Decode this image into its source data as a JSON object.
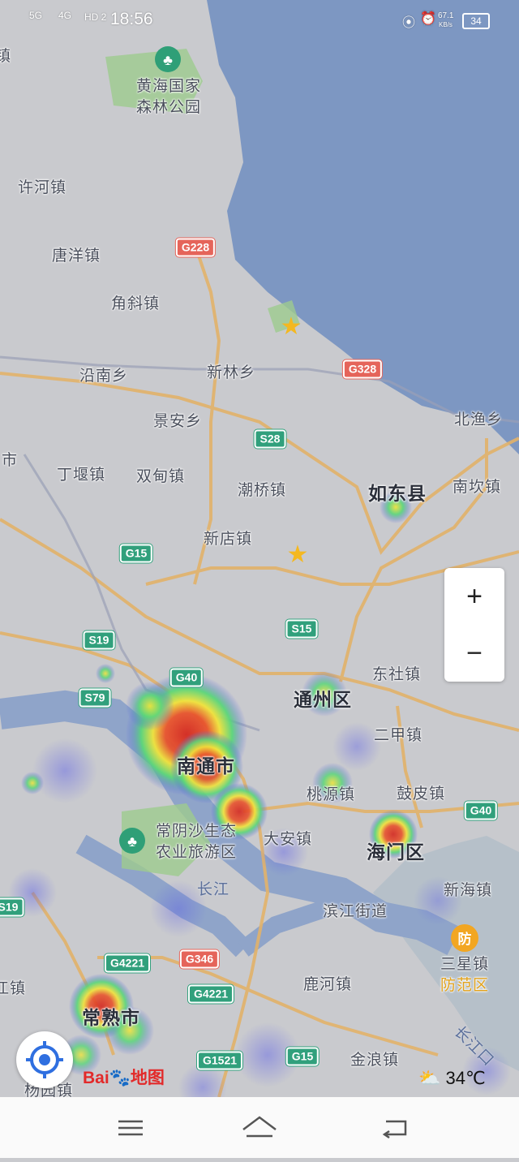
{
  "status_bar": {
    "network": "5G",
    "network2": "4G",
    "hd": "HD 2",
    "time": "18:56",
    "speed_value": "67.1",
    "speed_unit": "KB/s",
    "battery": "34"
  },
  "map": {
    "places": [
      {
        "name": "黄海国家\n森林公园",
        "kind": "park"
      },
      {
        "name": "许河镇"
      },
      {
        "name": "唐洋镇"
      },
      {
        "name": "角斜镇"
      },
      {
        "name": "沿南乡"
      },
      {
        "name": "新林乡"
      },
      {
        "name": "景安乡"
      },
      {
        "name": "北渔乡"
      },
      {
        "name": "丁堰镇"
      },
      {
        "name": "双甸镇"
      },
      {
        "name": "潮桥镇"
      },
      {
        "name": "如东县",
        "kind": "county"
      },
      {
        "name": "南坎镇"
      },
      {
        "name": "新店镇"
      },
      {
        "name": "东社镇"
      },
      {
        "name": "通州区",
        "kind": "county"
      },
      {
        "name": "二甲镇"
      },
      {
        "name": "南通市",
        "kind": "city"
      },
      {
        "name": "桃源镇"
      },
      {
        "name": "鼓皮镇"
      },
      {
        "name": "常阴沙生态\n农业旅游区",
        "kind": "park"
      },
      {
        "name": "大安镇"
      },
      {
        "name": "海门区",
        "kind": "county"
      },
      {
        "name": "长江",
        "kind": "water"
      },
      {
        "name": "新海镇"
      },
      {
        "name": "滨江街道"
      },
      {
        "name": "三星镇"
      },
      {
        "name": "防范区",
        "kind": "alert"
      },
      {
        "name": "鹿河镇"
      },
      {
        "name": "常熟市",
        "kind": "county"
      },
      {
        "name": "金浪镇"
      },
      {
        "name": "长江口",
        "kind": "water"
      },
      {
        "name": "杨园镇"
      },
      {
        "name": "镇"
      },
      {
        "name": "市"
      },
      {
        "name": "江镇"
      }
    ],
    "shields": [
      {
        "label": "G228",
        "color": "red"
      },
      {
        "label": "G328",
        "color": "red"
      },
      {
        "label": "S28",
        "color": "green"
      },
      {
        "label": "G15",
        "color": "green"
      },
      {
        "label": "S15",
        "color": "green"
      },
      {
        "label": "S19",
        "color": "green"
      },
      {
        "label": "G40",
        "color": "green"
      },
      {
        "label": "S79",
        "color": "green"
      },
      {
        "label": "G40",
        "color": "green"
      },
      {
        "label": "G4221",
        "color": "green"
      },
      {
        "label": "G346",
        "color": "red"
      },
      {
        "label": "G4221",
        "color": "green"
      },
      {
        "label": "G1521",
        "color": "green"
      },
      {
        "label": "G15",
        "color": "green"
      },
      {
        "label": "S19",
        "color": "green"
      }
    ],
    "alert_badge": "防",
    "colors": {
      "sea": "#7d97c2",
      "land": "#c9cace",
      "road": "#e2b26a",
      "river": "#8fa4c9",
      "heat_hot": "#e0342c",
      "heat_warm": "#f1e33b",
      "heat_cool": "#5bd67a",
      "heat_cold": "#5a5de8"
    }
  },
  "controls": {
    "zoom_in": "+",
    "zoom_out": "−",
    "brand": "Bai",
    "brand_suffix": "地图",
    "weather_temp": "34℃"
  },
  "nav": {
    "menu": "menu",
    "home": "home",
    "back": "back"
  }
}
